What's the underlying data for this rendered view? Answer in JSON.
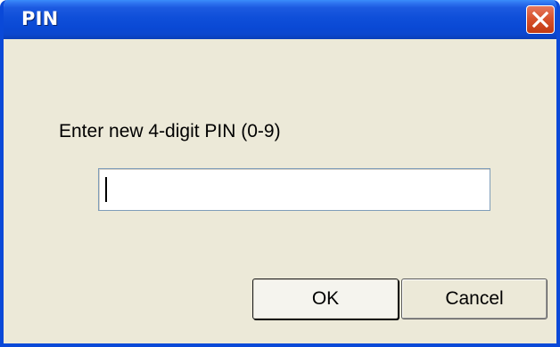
{
  "window": {
    "title": "PIN",
    "close_icon": "close-x-icon",
    "colors": {
      "titlebar": "#0A49D5",
      "face": "#ECE9D8",
      "close": "#D8532E"
    }
  },
  "prompt": {
    "label": "Enter new 4-digit PIN (0-9)"
  },
  "pin_field": {
    "value": "",
    "placeholder": ""
  },
  "buttons": {
    "ok_label": "OK",
    "cancel_label": "Cancel"
  }
}
